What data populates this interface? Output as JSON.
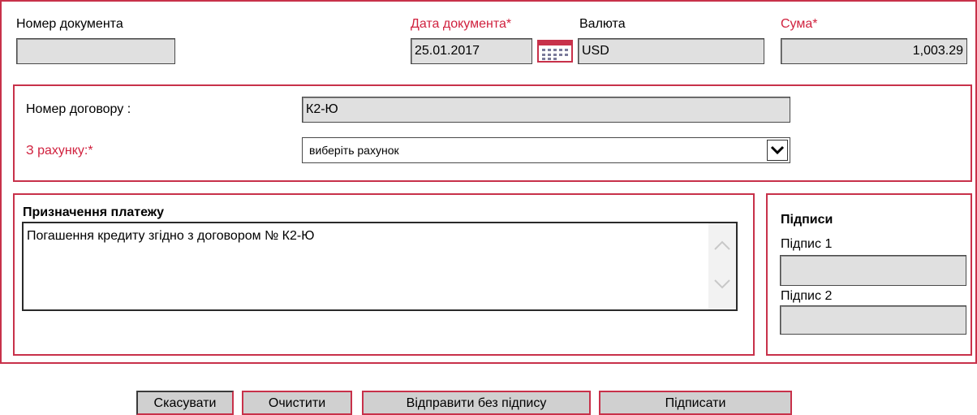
{
  "header": {
    "doc_number_label": "Номер документа",
    "doc_number_value": "",
    "doc_date_label": "Дата документа",
    "doc_date_value": "25.01.2017",
    "currency_label": "Валюта",
    "currency_value": "USD",
    "amount_label": "Сума",
    "amount_value": "1,003.29",
    "required_mark": "*"
  },
  "contract": {
    "contract_label": "Номер договору :",
    "contract_value": "К2-Ю",
    "account_label": "З рахунку:",
    "account_selected": "виберіть рахунок"
  },
  "purpose": {
    "label": "Призначення платежу",
    "value": "Погашення кредиту згідно з договором № К2-Ю"
  },
  "signatures": {
    "title": "Підписи",
    "sig1_label": "Підпис 1",
    "sig1_value": "",
    "sig2_label": "Підпис 2",
    "sig2_value": ""
  },
  "actions": {
    "cancel": "Скасувати",
    "clear": "Очистити",
    "send_unsigned": "Відправити без підпису",
    "sign": "Підписати"
  },
  "colors": {
    "accent": "#c8314a",
    "required": "#d0213e",
    "field_bg": "#e0e0e0"
  }
}
